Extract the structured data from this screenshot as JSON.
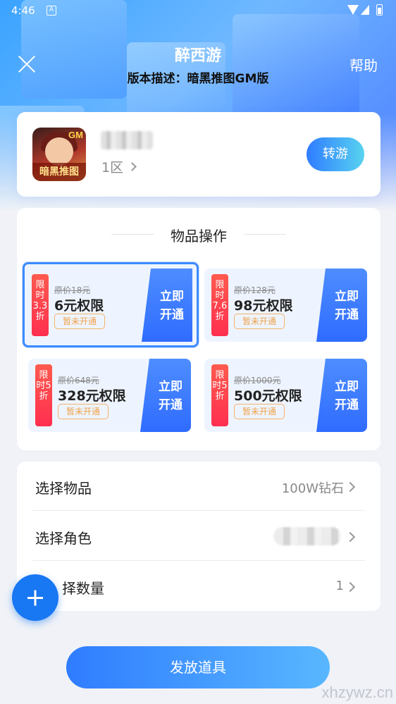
{
  "status_bar": {
    "time": "4:46",
    "notification_icon": "A"
  },
  "header": {
    "title": "醉西游",
    "subtitle": "版本描述：暗黑推图GM版",
    "help": "帮助"
  },
  "game": {
    "icon_badge": "GM",
    "icon_banner": "暗黑推图",
    "server": "1区",
    "transfer_label": "转游"
  },
  "items_section": {
    "title": "物品操作",
    "items": [
      {
        "tag": "限时3.3折",
        "original": "原价18元",
        "name": "6元权限",
        "status": "暂未开通",
        "button": "立即开通"
      },
      {
        "tag": "限时7.6折",
        "original": "原价128元",
        "name": "98元权限",
        "status": "暂未开通",
        "button": "立即开通"
      },
      {
        "tag": "限时5折",
        "original": "原价648元",
        "name": "328元权限",
        "status": "暂未开通",
        "button": "立即开通"
      },
      {
        "tag": "限时5折",
        "original": "原价1000元",
        "name": "500元权限",
        "status": "暂未开通",
        "button": "立即开通"
      }
    ]
  },
  "form": {
    "select_item": {
      "label": "选择物品",
      "value": "100W钻石"
    },
    "select_role": {
      "label": "选择角色"
    },
    "select_quantity": {
      "label": "择数量",
      "value": "1"
    }
  },
  "submit_label": "发放道具",
  "watermark": "xhzywz.cn",
  "colors": {
    "accent": "#2f7cff",
    "tag_red": "#ff3b4f",
    "pill_orange": "#f0a24a"
  }
}
